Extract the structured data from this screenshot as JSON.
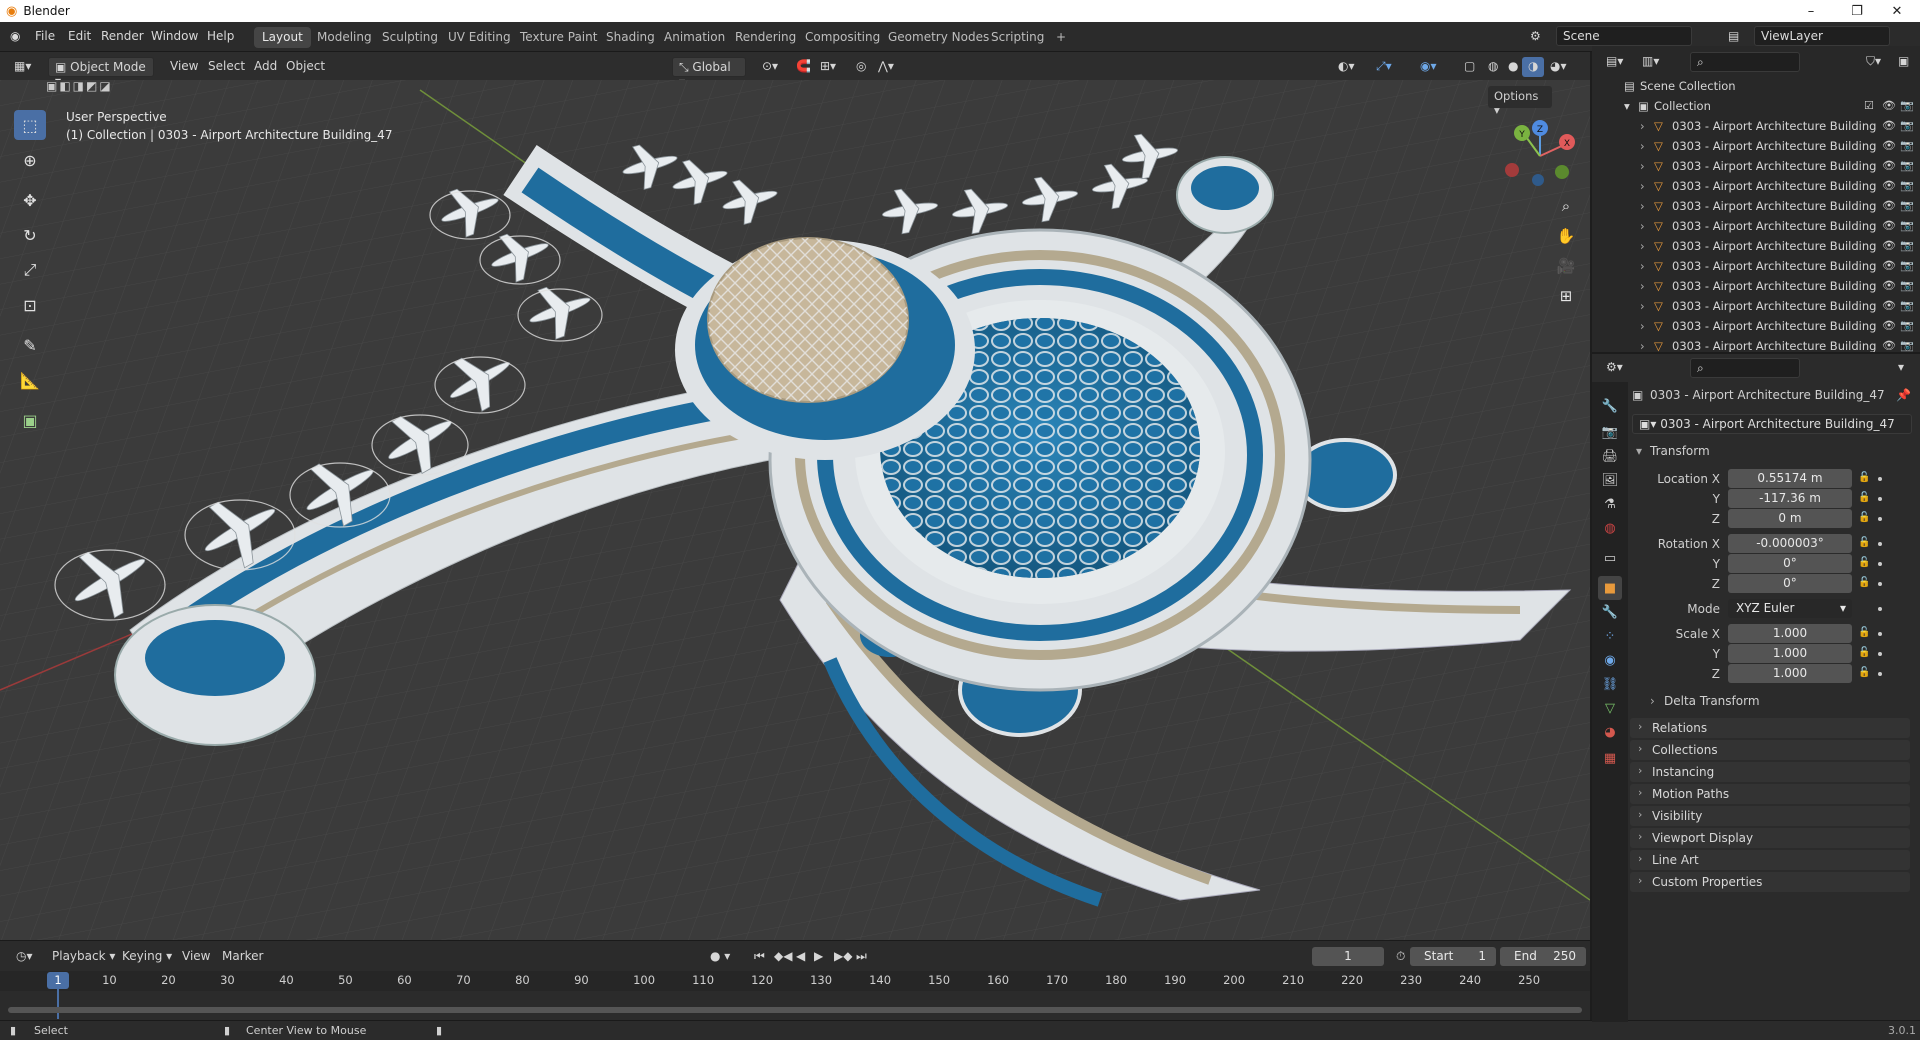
{
  "window": {
    "app_name": "Blender"
  },
  "topbar": {
    "menus": [
      "File",
      "Edit",
      "Render",
      "Window",
      "Help"
    ],
    "workspaces": [
      "Layout",
      "Modeling",
      "Sculpting",
      "UV Editing",
      "Texture Paint",
      "Shading",
      "Animation",
      "Rendering",
      "Compositing",
      "Geometry Nodes",
      "Scripting"
    ],
    "add_tab": "+",
    "scene": "Scene",
    "view_layer": "ViewLayer"
  },
  "viewport_header": {
    "mode": "Object Mode",
    "menus": [
      "View",
      "Select",
      "Add",
      "Object"
    ],
    "orientation": "Global",
    "options": "Options"
  },
  "viewport": {
    "perspective": "User Perspective",
    "collection_info": "(1) Collection | 0303 - Airport Architecture Building_47",
    "gizmo_axes": [
      "Y",
      "Z",
      "X"
    ]
  },
  "tools": [
    "select-box",
    "cursor",
    "move",
    "rotate",
    "scale",
    "transform",
    "annotate",
    "measure",
    "add-cube"
  ],
  "outliner": {
    "root": "Scene Collection",
    "collection": "Collection",
    "items": [
      "0303 - Airport Architecture Building",
      "0303 - Airport Architecture Building",
      "0303 - Airport Architecture Building",
      "0303 - Airport Architecture Building",
      "0303 - Airport Architecture Building",
      "0303 - Airport Architecture Building",
      "0303 - Airport Architecture Building",
      "0303 - Airport Architecture Building",
      "0303 - Airport Architecture Building",
      "0303 - Airport Architecture Building",
      "0303 - Airport Architecture Building",
      "0303 - Airport Architecture Building"
    ]
  },
  "properties": {
    "object_name": "0303 - Airport Architecture Building_47",
    "object_field": "0303 - Airport Architecture Building_47",
    "transform_label": "Transform",
    "location_label": "Location X",
    "rotation_label": "Rotation X",
    "mode_label": "Mode",
    "scale_label": "Scale X",
    "y": "Y",
    "z": "Z",
    "location": [
      "0.55174 m",
      "-117.36 m",
      "0 m"
    ],
    "rotation": [
      "-0.000003°",
      "0°",
      "0°"
    ],
    "rotation_mode": "XYZ Euler",
    "scale": [
      "1.000",
      "1.000",
      "1.000"
    ],
    "delta_transform": "Delta Transform",
    "panels": [
      "Relations",
      "Collections",
      "Instancing",
      "Motion Paths",
      "Visibility",
      "Viewport Display",
      "Line Art",
      "Custom Properties"
    ]
  },
  "timeline": {
    "menus": [
      "Playback",
      "Keying",
      "View",
      "Marker"
    ],
    "current_frame": "1",
    "start_label": "Start",
    "start": "1",
    "end_label": "End",
    "end": "250",
    "ticks": [
      "1",
      "10",
      "20",
      "30",
      "40",
      "50",
      "60",
      "70",
      "80",
      "90",
      "100",
      "110",
      "120",
      "130",
      "140",
      "150",
      "160",
      "170",
      "180",
      "190",
      "200",
      "210",
      "220",
      "230",
      "240",
      "250"
    ]
  },
  "statusbar": {
    "select": "Select",
    "center_view": "Center View to Mouse",
    "version": "3.0.1"
  },
  "colors": {
    "accent": "#4a6fa5",
    "building_blue": "#1f6d9e",
    "building_white": "#dfe3e6",
    "building_sand": "#b4a98f"
  }
}
